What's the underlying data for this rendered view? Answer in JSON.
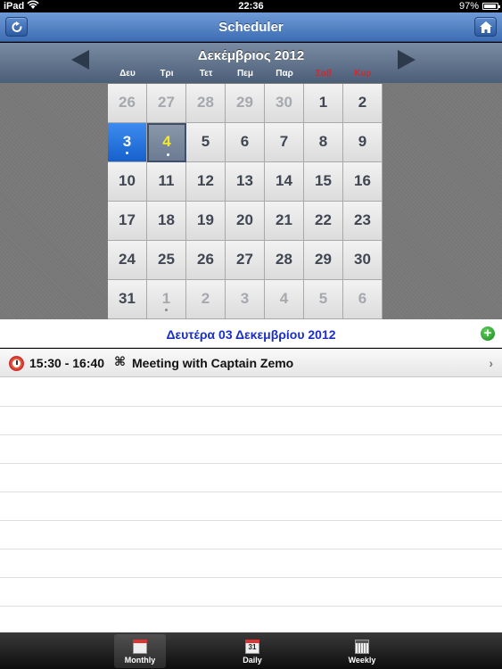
{
  "status": {
    "carrier": "iPad",
    "time": "22:36",
    "battery": "97%"
  },
  "navbar": {
    "title": "Scheduler",
    "refresh_icon": "refresh-icon",
    "home_icon": "home-icon"
  },
  "calendar": {
    "month_title": "Δεκέμβριος 2012",
    "weekdays": [
      "Δευ",
      "Τρι",
      "Τετ",
      "Πεμ",
      "Παρ",
      "Σαβ",
      "Κυρ"
    ],
    "weekend_color": "#d2282c",
    "days": [
      {
        "n": "26",
        "other": true
      },
      {
        "n": "27",
        "other": true
      },
      {
        "n": "28",
        "other": true
      },
      {
        "n": "29",
        "other": true
      },
      {
        "n": "30",
        "other": true
      },
      {
        "n": "1"
      },
      {
        "n": "2"
      },
      {
        "n": "3",
        "selected": true,
        "dot": true
      },
      {
        "n": "4",
        "today": true,
        "dot": true
      },
      {
        "n": "5"
      },
      {
        "n": "6"
      },
      {
        "n": "7"
      },
      {
        "n": "8"
      },
      {
        "n": "9"
      },
      {
        "n": "10"
      },
      {
        "n": "11"
      },
      {
        "n": "12"
      },
      {
        "n": "13"
      },
      {
        "n": "14"
      },
      {
        "n": "15"
      },
      {
        "n": "16"
      },
      {
        "n": "17"
      },
      {
        "n": "18"
      },
      {
        "n": "19"
      },
      {
        "n": "20"
      },
      {
        "n": "21"
      },
      {
        "n": "22"
      },
      {
        "n": "23"
      },
      {
        "n": "24"
      },
      {
        "n": "25"
      },
      {
        "n": "26"
      },
      {
        "n": "27"
      },
      {
        "n": "28"
      },
      {
        "n": "29"
      },
      {
        "n": "30"
      },
      {
        "n": "31"
      },
      {
        "n": "1",
        "other": true,
        "dot": true
      },
      {
        "n": "2",
        "other": true
      },
      {
        "n": "3",
        "other": true
      },
      {
        "n": "4",
        "other": true
      },
      {
        "n": "5",
        "other": true
      },
      {
        "n": "6",
        "other": true
      }
    ]
  },
  "day": {
    "title": "Δευτέρα 03 Δεκεμβρίου 2012",
    "add_icon": "add-icon"
  },
  "events": [
    {
      "time": "15:30 - 16:40",
      "symbol": "⌘",
      "title": "Meeting with Captain Zemo"
    }
  ],
  "tabs": [
    {
      "label": "Monthly",
      "icon": "calendar-icon",
      "active": true
    },
    {
      "label": "Daily",
      "icon": "calendar-day-icon",
      "day": "31"
    },
    {
      "label": "Weekly",
      "icon": "week-icon"
    }
  ]
}
